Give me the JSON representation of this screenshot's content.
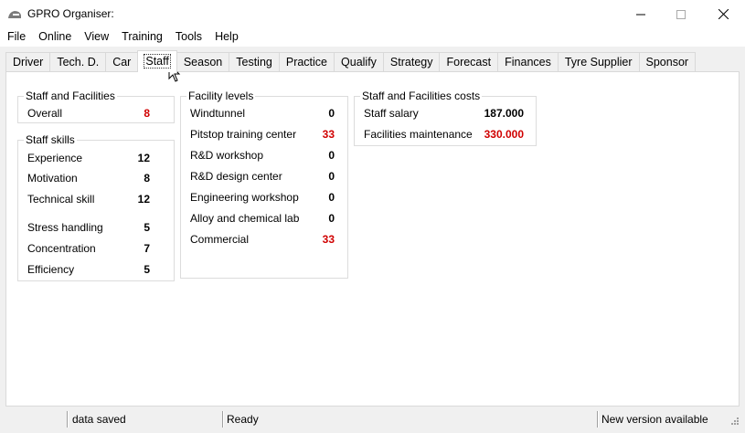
{
  "window": {
    "title": "GPRO Organiser:",
    "controls": {
      "minimize": "—",
      "maximize": "☐",
      "close": "✕"
    }
  },
  "menu": [
    "File",
    "Online",
    "View",
    "Training",
    "Tools",
    "Help"
  ],
  "tabs": {
    "items": [
      "Driver",
      "Tech. D.",
      "Car",
      "Staff",
      "Season",
      "Testing",
      "Practice",
      "Qualify",
      "Strategy",
      "Forecast",
      "Finances",
      "Tyre Supplier",
      "Sponsor"
    ],
    "selected": "Staff"
  },
  "staff_and_facilities": {
    "title": "Staff and Facilities",
    "overall_label": "Overall",
    "overall_value": "8"
  },
  "staff_skills": {
    "title": "Staff skills",
    "rows": [
      {
        "label": "Experience",
        "value": "12"
      },
      {
        "label": "Motivation",
        "value": "8"
      },
      {
        "label": "Technical skill",
        "value": "12"
      },
      {
        "label": "Stress handling",
        "value": "5"
      },
      {
        "label": "Concentration",
        "value": "7"
      },
      {
        "label": "Efficiency",
        "value": "5"
      }
    ]
  },
  "facility_levels": {
    "title": "Facility levels",
    "rows": [
      {
        "label": "Windtunnel",
        "value": "0",
        "highlight": false
      },
      {
        "label": "Pitstop training center",
        "value": "33",
        "highlight": true
      },
      {
        "label": "R&D workshop",
        "value": "0",
        "highlight": false
      },
      {
        "label": "R&D design center",
        "value": "0",
        "highlight": false
      },
      {
        "label": "Engineering workshop",
        "value": "0",
        "highlight": false
      },
      {
        "label": "Alloy and chemical lab",
        "value": "0",
        "highlight": false
      },
      {
        "label": "Commercial",
        "value": "33",
        "highlight": true
      }
    ]
  },
  "costs": {
    "title": "Staff and Facilities costs",
    "rows": [
      {
        "label": "Staff salary",
        "value": "187.000",
        "highlight": false
      },
      {
        "label": "Facilities maintenance",
        "value": "330.000",
        "highlight": true
      }
    ]
  },
  "status": {
    "left": "data saved",
    "middle": "Ready",
    "right": "New version available"
  },
  "colors": {
    "highlight": "#d00000",
    "tab_border": "#d9d9d9"
  }
}
